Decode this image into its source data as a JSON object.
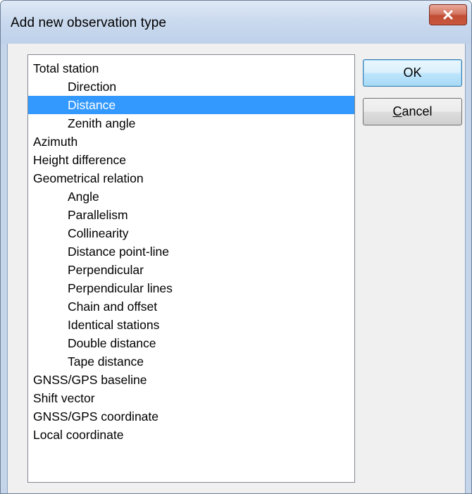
{
  "window": {
    "title": "Add new observation type",
    "close_icon": "close-x-icon",
    "close_color": "#c24d35"
  },
  "list": {
    "items": [
      {
        "label": "Total station",
        "indent": false
      },
      {
        "label": "Direction",
        "indent": true
      },
      {
        "label": "Distance",
        "indent": true,
        "selected": true
      },
      {
        "label": "Zenith angle",
        "indent": true
      },
      {
        "label": "Azimuth",
        "indent": false
      },
      {
        "label": "Height difference",
        "indent": false
      },
      {
        "label": "Geometrical relation",
        "indent": false
      },
      {
        "label": "Angle",
        "indent": true
      },
      {
        "label": "Parallelism",
        "indent": true
      },
      {
        "label": "Collinearity",
        "indent": true
      },
      {
        "label": "Distance point-line",
        "indent": true
      },
      {
        "label": "Perpendicular",
        "indent": true
      },
      {
        "label": "Perpendicular lines",
        "indent": true
      },
      {
        "label": "Chain and offset",
        "indent": true
      },
      {
        "label": "Identical stations",
        "indent": true
      },
      {
        "label": "Double distance",
        "indent": true
      },
      {
        "label": "Tape distance",
        "indent": true
      },
      {
        "label": "GNSS/GPS baseline",
        "indent": false
      },
      {
        "label": "Shift vector",
        "indent": false
      },
      {
        "label": "GNSS/GPS coordinate",
        "indent": false
      },
      {
        "label": "Local coordinate",
        "indent": false
      }
    ],
    "selection_color": "#3399ff"
  },
  "buttons": {
    "ok_label": "OK",
    "cancel_mnemonic": "C",
    "cancel_rest": "ancel"
  }
}
